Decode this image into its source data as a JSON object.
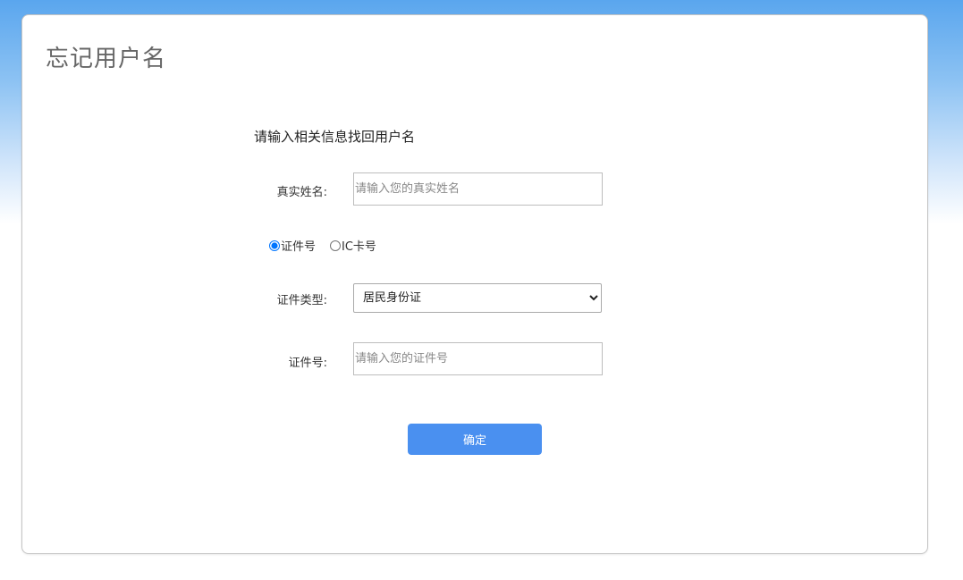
{
  "page": {
    "title": "忘记用户名",
    "subtitle": "请输入相关信息找回用户名"
  },
  "form": {
    "real_name": {
      "label": "真实姓名:",
      "placeholder": "请输入您的真实姓名",
      "value": ""
    },
    "id_mode": {
      "options": [
        {
          "label": "证件号",
          "selected": true
        },
        {
          "label": "IC卡号",
          "selected": false
        }
      ]
    },
    "id_type": {
      "label": "证件类型:",
      "selected": "居民身份证"
    },
    "id_number": {
      "label": "证件号:",
      "placeholder": "请输入您的证件号",
      "value": ""
    },
    "submit_label": "确定"
  },
  "colors": {
    "background_top": "#5aa6ee",
    "primary_button": "#4a90f0",
    "title_text": "#666666"
  }
}
